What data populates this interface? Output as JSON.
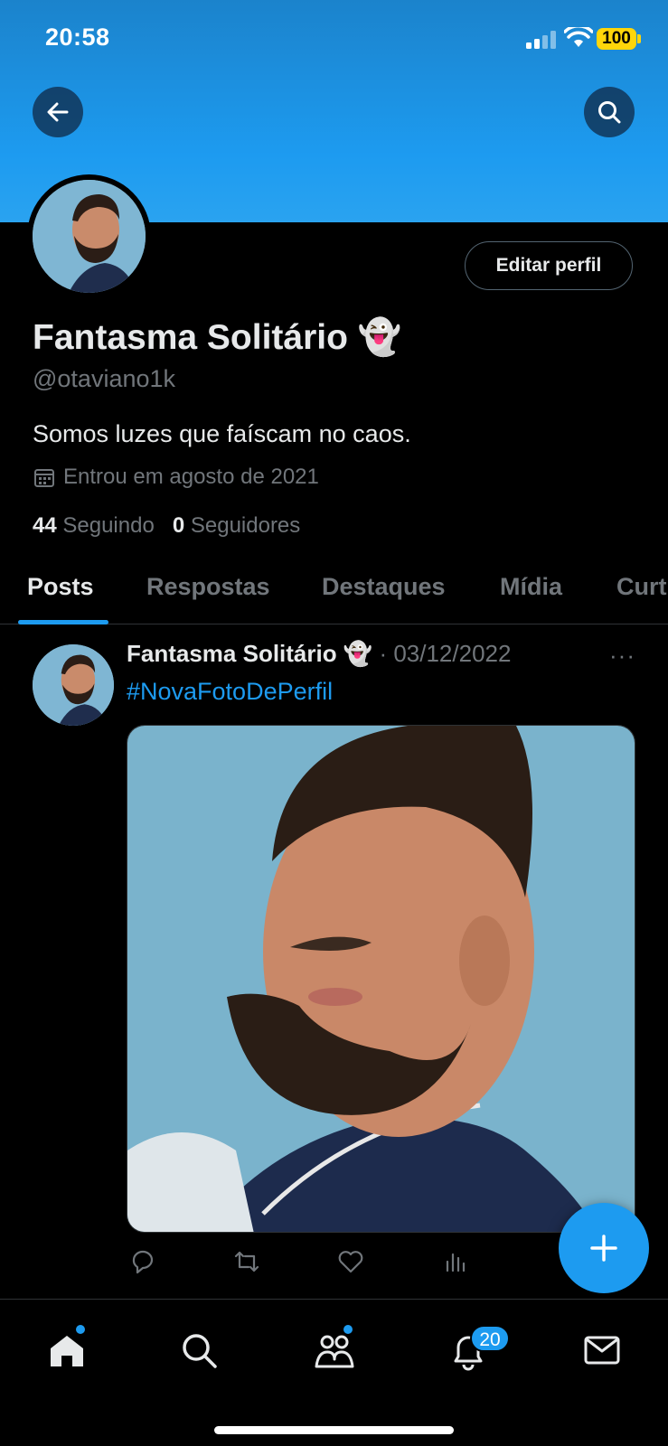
{
  "status_bar": {
    "time": "20:58",
    "battery": "100"
  },
  "profile": {
    "display_name": "Fantasma Solitário 👻",
    "handle": "@otaviano1k",
    "bio": "Somos luzes que faíscam no caos.",
    "joined": "Entrou em agosto de 2021",
    "following_count": "44",
    "following_label": "Seguindo",
    "followers_count": "0",
    "followers_label": "Seguidores",
    "edit_button": "Editar perfil"
  },
  "tabs": [
    {
      "label": "Posts",
      "active": true
    },
    {
      "label": "Respostas",
      "active": false
    },
    {
      "label": "Destaques",
      "active": false
    },
    {
      "label": "Mídia",
      "active": false
    },
    {
      "label": "Curt",
      "active": false
    }
  ],
  "post": {
    "author": "Fantasma Solitário 👻",
    "separator": " · ",
    "date": "03/12/2022",
    "more": "···",
    "text": "#NovaFotoDePerfil"
  },
  "nav": {
    "notifications_badge": "20"
  },
  "colors": {
    "accent": "#1d9bf0",
    "background": "#000000",
    "muted": "#71767b"
  },
  "icons": [
    "back-arrow-icon",
    "search-icon",
    "calendar-icon",
    "reply-icon",
    "repost-icon",
    "like-icon",
    "views-icon",
    "compose-plus-icon",
    "home-icon",
    "explore-icon",
    "communities-icon",
    "notifications-icon",
    "messages-icon"
  ]
}
